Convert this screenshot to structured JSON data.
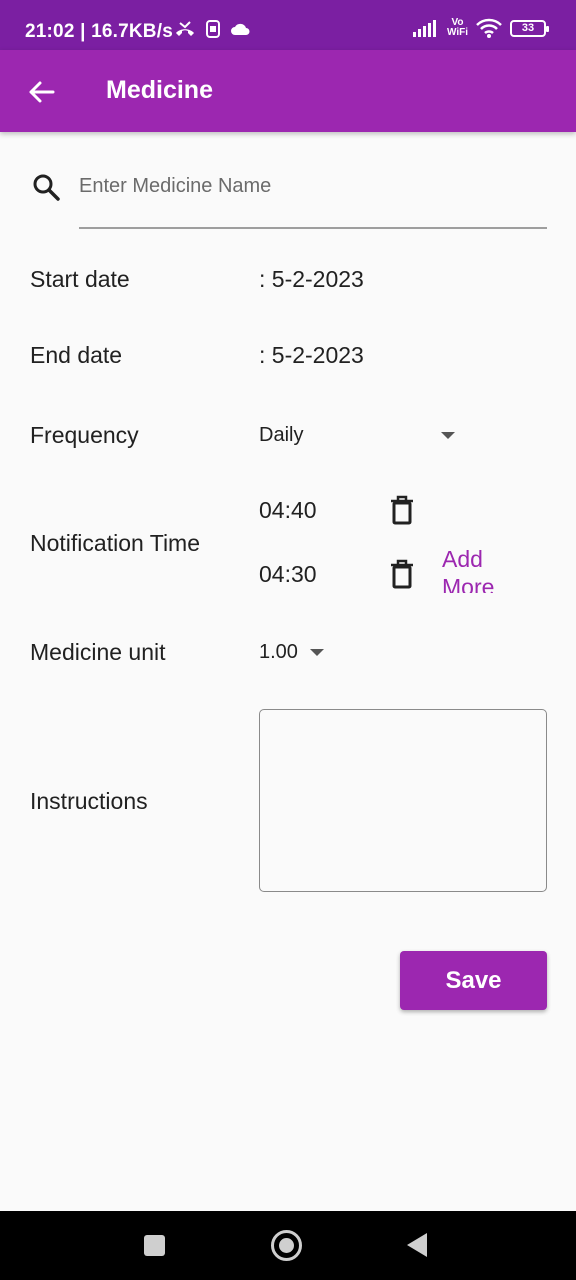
{
  "status_bar": {
    "time": "21:02",
    "speed": "| 16.7KB/s",
    "vowifi_top": "Vo",
    "vowifi_bottom": "WiFi",
    "battery": "33"
  },
  "app_bar": {
    "title": "Medicine",
    "color": "#9c27b0"
  },
  "search": {
    "placeholder": "Enter Medicine Name",
    "value": ""
  },
  "form": {
    "start_date_label": "Start date",
    "start_date_value": ": 5-2-2023",
    "end_date_label": "End date",
    "end_date_value": ": 5-2-2023",
    "frequency_label": "Frequency",
    "frequency_value": "Daily",
    "notification_label": "Notification Time",
    "notification_times": [
      "04:40",
      "04:30"
    ],
    "add_more_label": "Add More",
    "medicine_unit_label": "Medicine unit",
    "medicine_unit_value": "1.00",
    "instructions_label": "Instructions",
    "instructions_value": ""
  },
  "actions": {
    "save_label": "Save"
  }
}
